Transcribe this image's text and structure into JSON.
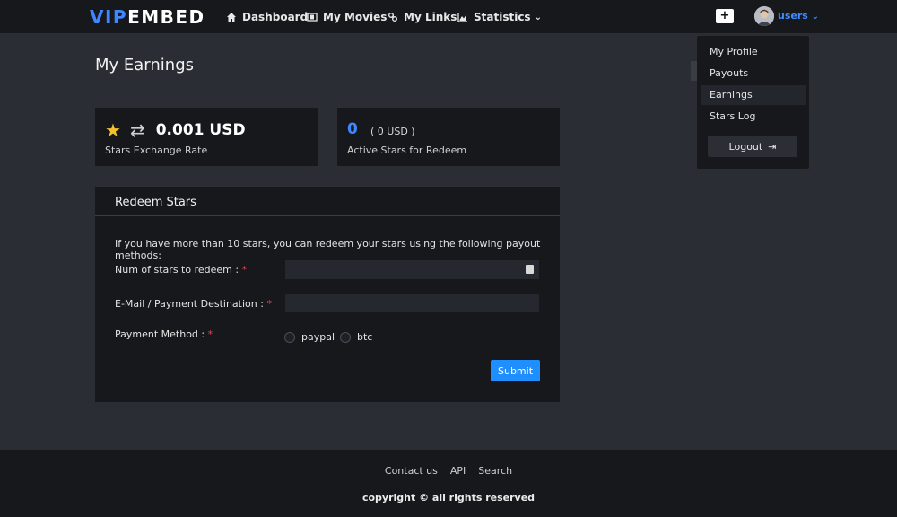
{
  "brand": {
    "logo_part1": "VIP",
    "logo_part2": "EMBED"
  },
  "nav": {
    "items": [
      {
        "label": "Dashboard",
        "icon": "home-icon"
      },
      {
        "label": "My Movies",
        "icon": "film-icon"
      },
      {
        "label": "My Links",
        "icon": "link-icon"
      },
      {
        "label": "Statistics",
        "icon": "chart-icon"
      }
    ],
    "statistics_caret": "⌄"
  },
  "header": {
    "add_button": "+",
    "user_label": "users",
    "user_caret": "⌄"
  },
  "user_menu": {
    "items": [
      {
        "label": "My Profile",
        "active": false
      },
      {
        "label": "Payouts",
        "active": false
      },
      {
        "label": "Earnings",
        "active": true
      },
      {
        "label": "Stars Log",
        "active": false
      }
    ],
    "logout_label": "Logout",
    "logout_icon": "⇥"
  },
  "page": {
    "title": "My Earnings"
  },
  "exchange_card": {
    "rate": "0.001 USD",
    "subtitle": "Stars Exchange Rate",
    "star_icon": "★",
    "exchange_icon": "⇄"
  },
  "stars_card": {
    "count": "0",
    "usd": "( 0 USD )",
    "subtitle": "Active Stars for Redeem"
  },
  "redeem": {
    "title": "Redeem Stars",
    "intro": "If you have more than 10 stars, you can redeem your stars using the following payout methods:",
    "num_stars_label": "Num of stars to redeem :",
    "num_stars_value": "",
    "email_label": "E-Mail / Payment Destination :",
    "email_value": "",
    "payment_label": "Payment Method :",
    "required_mark": "*",
    "methods": [
      "paypal",
      "btc"
    ],
    "submit_label": "Submit"
  },
  "footer": {
    "links": [
      "Contact us",
      "API",
      "Search"
    ],
    "copyright": "copyright © all rights reserved"
  },
  "colors": {
    "accent": "#1f8fff",
    "logo_blue": "#3f86ff",
    "star": "#f2c12e",
    "required": "#e4474f"
  }
}
